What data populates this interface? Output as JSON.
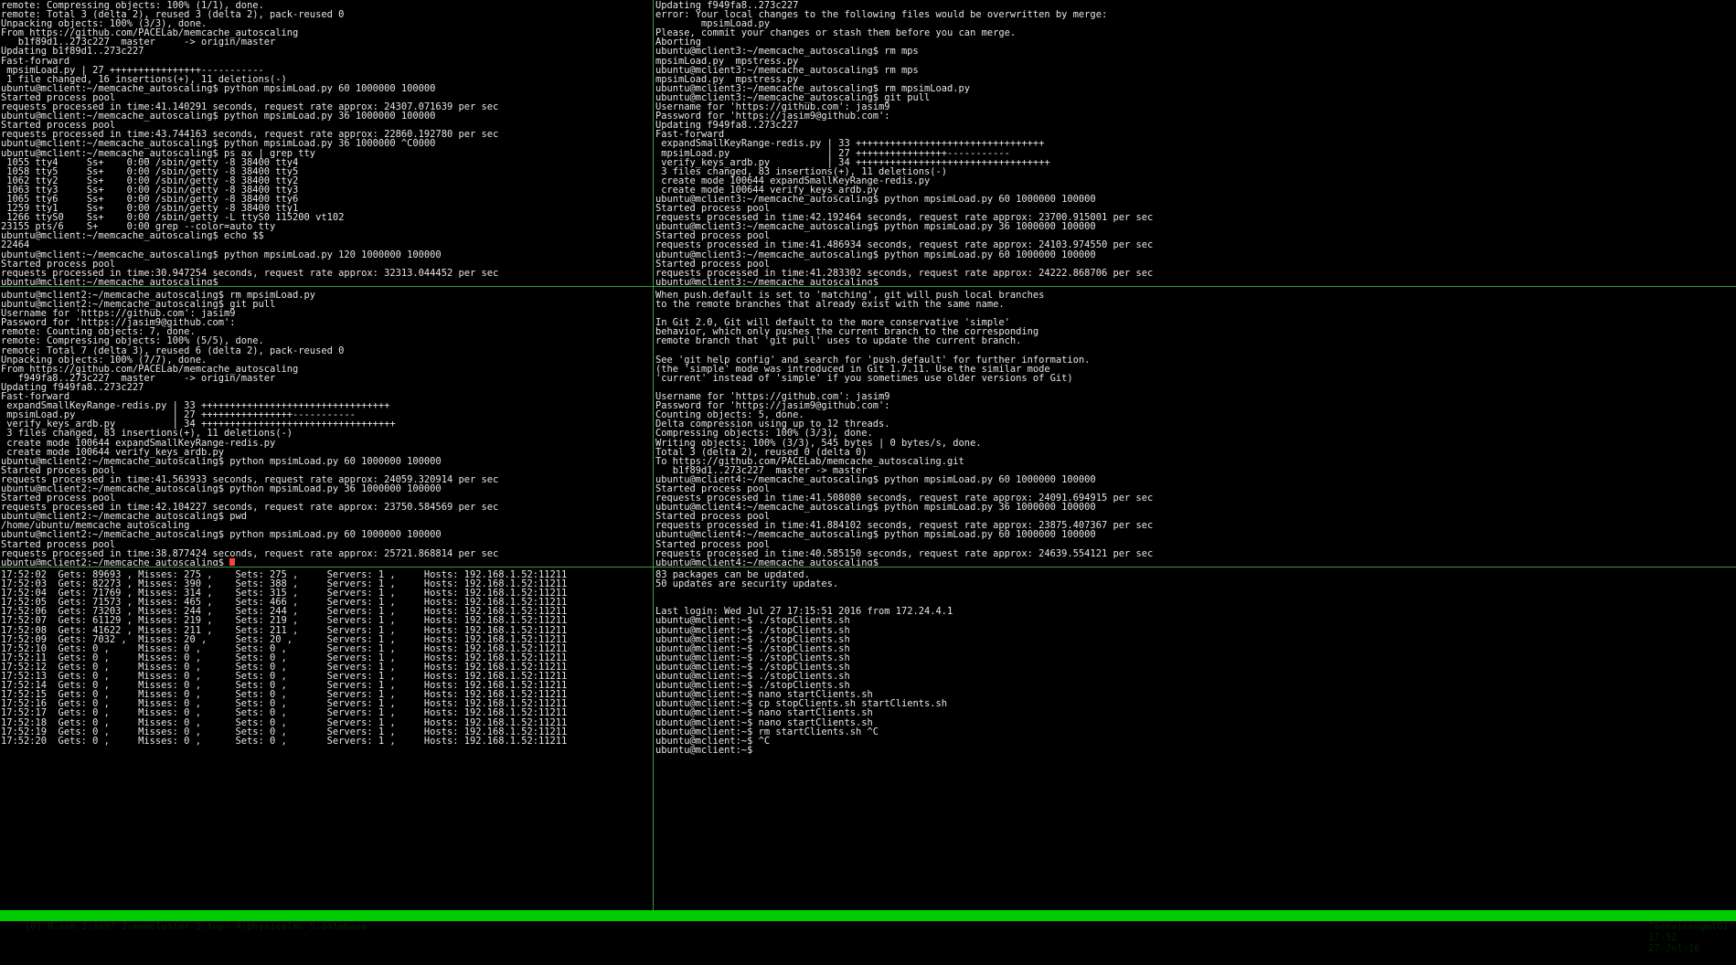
{
  "panes": {
    "top_left": [
      "remote: Compressing objects: 100% (1/1), done.",
      "remote: Total 3 (delta 2), reused 3 (delta 2), pack-reused 0",
      "Unpacking objects: 100% (3/3), done.",
      "From https://github.com/PACELab/memcache_autoscaling",
      "   b1f89d1..273c227  master     -> origin/master",
      "Updating b1f89d1..273c227",
      "Fast-forward",
      " mpsimLoad.py | 27 ++++++++++++++++-----------",
      " 1 file changed, 16 insertions(+), 11 deletions(-)",
      "ubuntu@mclient:~/memcache_autoscaling$ python mpsimLoad.py 60 1000000 100000",
      "Started process pool",
      "requests processed in time:41.140291 seconds, request rate approx: 24307.071639 per sec",
      "ubuntu@mclient:~/memcache_autoscaling$ python mpsimLoad.py 36 1000000 100000",
      "Started process pool",
      "requests processed in time:43.744163 seconds, request rate approx: 22860.192780 per sec",
      "ubuntu@mclient:~/memcache_autoscaling$ python mpsimLoad.py 36 1000000 ^C0000",
      "ubuntu@mclient:~/memcache_autoscaling$ ps ax | grep tty",
      " 1055 tty4     Ss+    0:00 /sbin/getty -8 38400 tty4",
      " 1058 tty5     Ss+    0:00 /sbin/getty -8 38400 tty5",
      " 1062 tty2     Ss+    0:00 /sbin/getty -8 38400 tty2",
      " 1063 tty3     Ss+    0:00 /sbin/getty -8 38400 tty3",
      " 1065 tty6     Ss+    0:00 /sbin/getty -8 38400 tty6",
      " 1259 tty1     Ss+    0:00 /sbin/getty -8 38400 tty1",
      " 1266 ttyS0    Ss+    0:00 /sbin/getty -L ttyS0 115200 vt102",
      "23155 pts/6    S+     0:00 grep --color=auto tty",
      "ubuntu@mclient:~/memcache_autoscaling$ echo $$",
      "22464",
      "ubuntu@mclient:~/memcache_autoscaling$ python mpsimLoad.py 120 1000000 100000",
      "Started process pool",
      "requests processed in time:30.947254 seconds, request rate approx: 32313.044452 per sec",
      "ubuntu@mclient:~/memcache_autoscaling$"
    ],
    "top_right": [
      "Updating f949fa8..273c227",
      "error: Your local changes to the following files would be overwritten by merge:",
      "        mpsimLoad.py",
      "Please, commit your changes or stash them before you can merge.",
      "Aborting",
      "ubuntu@mclient3:~/memcache_autoscaling$ rm mps",
      "mpsimLoad.py  mpstress.py",
      "ubuntu@mclient3:~/memcache_autoscaling$ rm mps",
      "mpsimLoad.py  mpstress.py",
      "ubuntu@mclient3:~/memcache_autoscaling$ rm mpsimLoad.py",
      "ubuntu@mclient3:~/memcache_autoscaling$ git pull",
      "Username for 'https://github.com': jasim9",
      "Password for 'https://jasim9@github.com':",
      "Updating f949fa8..273c227",
      "Fast-forward",
      " expandSmallKeyRange-redis.py | 33 +++++++++++++++++++++++++++++++++",
      " mpsimLoad.py                 | 27 ++++++++++++++++-----------",
      " verify_keys_ardb.py          | 34 ++++++++++++++++++++++++++++++++++",
      " 3 files changed, 83 insertions(+), 11 deletions(-)",
      " create mode 100644 expandSmallKeyRange-redis.py",
      " create mode 100644 verify_keys_ardb.py",
      "ubuntu@mclient3:~/memcache_autoscaling$ python mpsimLoad.py 60 1000000 100000",
      "Started process pool",
      "requests processed in time:42.192464 seconds, request rate approx: 23700.915001 per sec",
      "ubuntu@mclient3:~/memcache_autoscaling$ python mpsimLoad.py 36 1000000 100000",
      "Started process pool",
      "requests processed in time:41.486934 seconds, request rate approx: 24103.974550 per sec",
      "ubuntu@mclient3:~/memcache_autoscaling$ python mpsimLoad.py 60 1000000 100000",
      "Started process pool",
      "requests processed in time:41.283302 seconds, request rate approx: 24222.868706 per sec",
      "ubuntu@mclient3:~/memcache_autoscaling$"
    ],
    "mid_left": [
      "ubuntu@mclient2:~/memcache_autoscaling$ rm mpsimLoad.py",
      "ubuntu@mclient2:~/memcache_autoscaling$ git pull",
      "Username for 'https://github.com': jasim9",
      "Password for 'https://jasim9@github.com':",
      "remote: Counting objects: 7, done.",
      "remote: Compressing objects: 100% (5/5), done.",
      "remote: Total 7 (delta 3), reused 6 (delta 2), pack-reused 0",
      "Unpacking objects: 100% (7/7), done.",
      "From https://github.com/PACELab/memcache_autoscaling",
      "   f949fa8..273c227  master     -> origin/master",
      "Updating f949fa8..273c227",
      "Fast-forward",
      " expandSmallKeyRange-redis.py | 33 +++++++++++++++++++++++++++++++++",
      " mpsimLoad.py                 | 27 ++++++++++++++++-----------",
      " verify_keys_ardb.py          | 34 ++++++++++++++++++++++++++++++++++",
      " 3 files changed, 83 insertions(+), 11 deletions(-)",
      " create mode 100644 expandSmallKeyRange-redis.py",
      " create mode 100644 verify_keys_ardb.py",
      "ubuntu@mclient2:~/memcache_autoscaling$ python mpsimLoad.py 60 1000000 100000",
      "Started process pool",
      "requests processed in time:41.563933 seconds, request rate approx: 24059.320914 per sec",
      "ubuntu@mclient2:~/memcache_autoscaling$ python mpsimLoad.py 36 1000000 100000",
      "Started process pool",
      "requests processed in time:42.104227 seconds, request rate approx: 23750.584569 per sec",
      "ubuntu@mclient2:~/memcache_autoscaling$ pwd",
      "/home/ubuntu/memcache_autoscaling",
      "ubuntu@mclient2:~/memcache_autoscaling$ python mpsimLoad.py 60 1000000 100000",
      "Started process pool",
      "requests processed in time:38.877424 seconds, request rate approx: 25721.868814 per sec",
      "ubuntu@mclient2:~/memcache_autoscaling$ "
    ],
    "mid_right": [
      "When push.default is set to 'matching', git will push local branches",
      "to the remote branches that already exist with the same name.",
      "",
      "In Git 2.0, Git will default to the more conservative 'simple'",
      "behavior, which only pushes the current branch to the corresponding",
      "remote branch that 'git pull' uses to update the current branch.",
      "",
      "See 'git help config' and search for 'push.default' for further information.",
      "(the 'simple' mode was introduced in Git 1.7.11. Use the similar mode",
      "'current' instead of 'simple' if you sometimes use older versions of Git)",
      "",
      "Username for 'https://github.com': jasim9",
      "Password for 'https://jasim9@github.com':",
      "Counting objects: 5, done.",
      "Delta compression using up to 12 threads.",
      "Compressing objects: 100% (3/3), done.",
      "Writing objects: 100% (3/3), 545 bytes | 0 bytes/s, done.",
      "Total 3 (delta 2), reused 0 (delta 0)",
      "To https://github.com/PACELab/memcache_autoscaling.git",
      "   b1f89d1..273c227  master -> master",
      "ubuntu@mclient4:~/memcache_autoscaling$ python mpsimLoad.py 60 1000000 100000",
      "Started process pool",
      "requests processed in time:41.508080 seconds, request rate approx: 24091.694915 per sec",
      "ubuntu@mclient4:~/memcache_autoscaling$ python mpsimLoad.py 36 1000000 100000",
      "Started process pool",
      "requests processed in time:41.884102 seconds, request rate approx: 23875.407367 per sec",
      "ubuntu@mclient4:~/memcache_autoscaling$ python mpsimLoad.py 60 1000000 100000",
      "Started process pool",
      "requests processed in time:40.585150 seconds, request rate approx: 24639.554121 per sec",
      "ubuntu@mclient4:~/memcache_autoscaling$"
    ],
    "bottom_left": [
      "17:52:02  Gets: 89693 , Misses: 275 ,    Sets: 275 ,     Servers: 1 ,     Hosts: 192.168.1.52:11211",
      "17:52:03  Gets: 82273 , Misses: 390 ,    Sets: 388 ,     Servers: 1 ,     Hosts: 192.168.1.52:11211",
      "17:52:04  Gets: 71769 , Misses: 314 ,    Sets: 315 ,     Servers: 1 ,     Hosts: 192.168.1.52:11211",
      "17:52:05  Gets: 71573 , Misses: 465 ,    Sets: 466 ,     Servers: 1 ,     Hosts: 192.168.1.52:11211",
      "17:52:06  Gets: 73203 , Misses: 244 ,    Sets: 244 ,     Servers: 1 ,     Hosts: 192.168.1.52:11211",
      "17:52:07  Gets: 61129 , Misses: 219 ,    Sets: 219 ,     Servers: 1 ,     Hosts: 192.168.1.52:11211",
      "17:52:08  Gets: 41622 , Misses: 211 ,    Sets: 211 ,     Servers: 1 ,     Hosts: 192.168.1.52:11211",
      "17:52:09  Gets: 7032 ,  Misses: 20 ,     Sets: 20 ,      Servers: 1 ,     Hosts: 192.168.1.52:11211",
      "17:52:10  Gets: 0 ,     Misses: 0 ,      Sets: 0 ,       Servers: 1 ,     Hosts: 192.168.1.52:11211",
      "17:52:11  Gets: 0 ,     Misses: 0 ,      Sets: 0 ,       Servers: 1 ,     Hosts: 192.168.1.52:11211",
      "17:52:12  Gets: 0 ,     Misses: 0 ,      Sets: 0 ,       Servers: 1 ,     Hosts: 192.168.1.52:11211",
      "17:52:13  Gets: 0 ,     Misses: 0 ,      Sets: 0 ,       Servers: 1 ,     Hosts: 192.168.1.52:11211",
      "17:52:14  Gets: 0 ,     Misses: 0 ,      Sets: 0 ,       Servers: 1 ,     Hosts: 192.168.1.52:11211",
      "17:52:15  Gets: 0 ,     Misses: 0 ,      Sets: 0 ,       Servers: 1 ,     Hosts: 192.168.1.52:11211",
      "17:52:16  Gets: 0 ,     Misses: 0 ,      Sets: 0 ,       Servers: 1 ,     Hosts: 192.168.1.52:11211",
      "17:52:17  Gets: 0 ,     Misses: 0 ,      Sets: 0 ,       Servers: 1 ,     Hosts: 192.168.1.52:11211",
      "17:52:18  Gets: 0 ,     Misses: 0 ,      Sets: 0 ,       Servers: 1 ,     Hosts: 192.168.1.52:11211",
      "17:52:19  Gets: 0 ,     Misses: 0 ,      Sets: 0 ,       Servers: 1 ,     Hosts: 192.168.1.52:11211",
      "17:52:20  Gets: 0 ,     Misses: 0 ,      Sets: 0 ,       Servers: 1 ,     Hosts: 192.168.1.52:11211"
    ],
    "bottom_right": [
      "83 packages can be updated.",
      "50 updates are security updates.",
      "",
      "",
      "Last login: Wed Jul 27 17:15:51 2016 from 172.24.4.1",
      "ubuntu@mclient:~$ ./stopClients.sh",
      "ubuntu@mclient:~$ ./stopClients.sh",
      "ubuntu@mclient:~$ ./stopClients.sh",
      "ubuntu@mclient:~$ ./stopClients.sh",
      "ubuntu@mclient:~$ ./stopClients.sh",
      "ubuntu@mclient:~$ ./stopClients.sh",
      "ubuntu@mclient:~$ ./stopClients.sh",
      "ubuntu@mclient:~$ ./stopClients.sh",
      "ubuntu@mclient:~$ nano startClients.sh",
      "ubuntu@mclient:~$ cp stopClients.sh startClients.sh",
      "ubuntu@mclient:~$ nano startClients.sh",
      "ubuntu@mclient:~$ nano startClients.sh",
      "ubuntu@mclient:~$ rm startClients.sh ^C",
      "ubuntu@mclient:~$ ^C",
      "ubuntu@mclient:~$"
    ]
  },
  "statusbar": {
    "session": "[0] ",
    "windows": [
      "0:ssh",
      "1:ssh*",
      "2:memcluster",
      "3:top-",
      "4:physicalmc",
      "5:database"
    ],
    "host": "\"servicemgmt01\"",
    "time": "17:52",
    "date": "27-Jul-16"
  },
  "colors": {
    "divider": "#3a9a3a",
    "statusbar_bg": "#00cc00",
    "tty_highlight": "#ff5050",
    "diff_plus": "#3ec83e",
    "diff_minus": "#ff4040"
  }
}
